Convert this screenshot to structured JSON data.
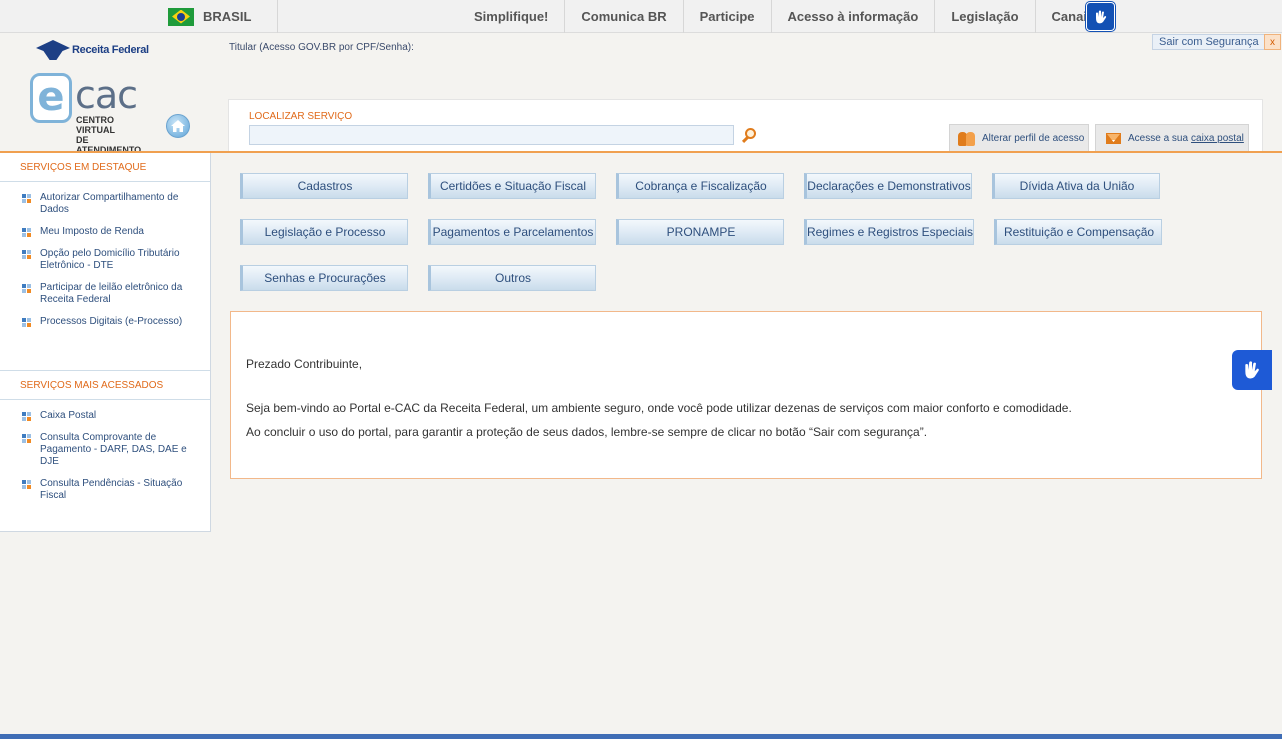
{
  "govbar": {
    "country": "BRASIL",
    "links": [
      "Simplifique!",
      "Comunica BR",
      "Participe",
      "Acesso à informação",
      "Legislação",
      "Canais"
    ],
    "accessibility_icon": "hand-sign-icon"
  },
  "header": {
    "rf_logo_text": "Receita Federal",
    "titular": "Titular (Acesso GOV.BR por CPF/Senha):",
    "sair_label": "Sair com Segurança",
    "close_label": "x",
    "ecac_e": "e",
    "ecac_cac": "cac",
    "ecac_sub_1": "CENTRO VIRTUAL",
    "ecac_sub_2": "DE ATENDIMENTO"
  },
  "search": {
    "label": "LOCALIZAR SERVIÇO",
    "value": "",
    "placeholder": ""
  },
  "actions": {
    "perfil": "Alterar perfil de acesso",
    "caixa_prefix": "Acesse a sua",
    "caixa_link": "caixa postal"
  },
  "sidebar": {
    "destaque_heading": "SERVIÇOS EM DESTAQUE",
    "destaque_items": [
      "Autorizar Compartilhamento de Dados",
      "Meu Imposto de Renda",
      "Opção pelo Domicílio Tributário Eletrônico - DTE",
      "Participar de leilão eletrônico da Receita Federal",
      "Processos Digitais (e-Processo)"
    ],
    "acessados_heading": "SERVIÇOS MAIS ACESSADOS",
    "acessados_items": [
      "Caixa Postal",
      "Consulta Comprovante de Pagamento - DARF, DAS, DAE e DJE",
      "Consulta Pendências - Situação Fiscal"
    ]
  },
  "categories": [
    "Cadastros",
    "Certidões e Situação Fiscal",
    "Cobrança e Fiscalização",
    "Declarações e Demonstrativos",
    "Dívida Ativa da União",
    "Legislação e Processo",
    "Pagamentos e Parcelamentos",
    "PRONAMPE",
    "Regimes e Registros Especiais",
    "Restituição e Compensação",
    "Senhas e Procurações",
    "Outros"
  ],
  "message": {
    "greeting": "Prezado Contribuinte,",
    "line1": "Seja bem-vindo ao Portal e-CAC da Receita Federal, um ambiente seguro, onde você pode utilizar dezenas de serviços com maior conforto e comodidade.",
    "line2": "Ao concluir o uso do portal, para garantir a proteção de seus dados, lembre-se sempre de clicar no botão “Sair com segurança”."
  },
  "colors": {
    "accent_orange": "#e06a1a",
    "link_blue": "#2e4f7d",
    "gov_blue": "#1351b4"
  }
}
